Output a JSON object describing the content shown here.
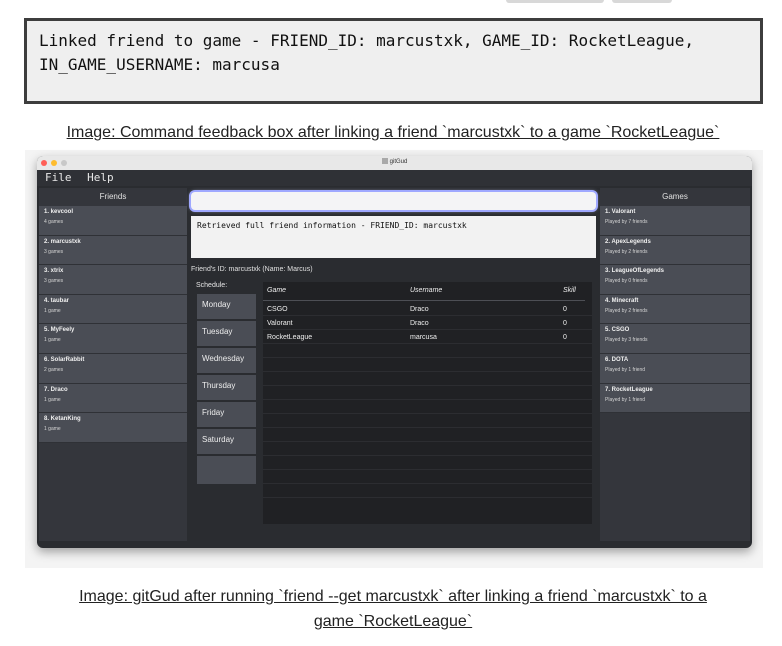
{
  "command_feedback": {
    "line1": "Linked friend to game - FRIEND_ID: marcustxk, GAME_ID: RocketLeague,",
    "line2": "IN_GAME_USERNAME: marcusa"
  },
  "caption1": "Image: Command feedback box after linking a friend `marcustxk` to a game `RocketLeague`",
  "caption2_line1": "Image: gitGud after running `friend --get marcustxk` after linking a friend `marcustxk` to a",
  "caption2_line2": "game `RocketLeague`",
  "app": {
    "window_title": "gitGud",
    "menu": [
      "File",
      "Help"
    ],
    "friends_header": "Friends",
    "games_header": "Games",
    "friends": [
      {
        "name": "1. kevcool",
        "sub": "4 games"
      },
      {
        "name": "2. marcustxk",
        "sub": "3 games"
      },
      {
        "name": "3. xtrix",
        "sub": "3 games"
      },
      {
        "name": "4. taubar",
        "sub": "1 game"
      },
      {
        "name": "5. MyFeely",
        "sub": "1 game"
      },
      {
        "name": "6. SolarRabbit",
        "sub": "2 games"
      },
      {
        "name": "7. Draco",
        "sub": "1 game"
      },
      {
        "name": "8. KetanKing",
        "sub": "1 game"
      }
    ],
    "games": [
      {
        "name": "1. Valorant",
        "sub": "Played by 7 friends"
      },
      {
        "name": "2. ApexLegends",
        "sub": "Played by 2 friends"
      },
      {
        "name": "3. LeagueOfLegends",
        "sub": "Played by 0 friends"
      },
      {
        "name": "4. Minecraft",
        "sub": "Played by 2 friends"
      },
      {
        "name": "5. CSGO",
        "sub": "Played by 3 friends"
      },
      {
        "name": "6. DOTA",
        "sub": "Played by 1 friend"
      },
      {
        "name": "7. RocketLeague",
        "sub": "Played by 1 friend"
      }
    ],
    "command_input_value": "",
    "result_text": "Retrieved full friend information - FRIEND_ID: marcustxk",
    "friend_id_label": "Friend's ID: marcustxk (Name: Marcus)",
    "schedule_label": "Schedule:",
    "days": [
      "Monday",
      "Tuesday",
      "Wednesday",
      "Thursday",
      "Friday",
      "Saturday",
      "Sunday"
    ],
    "table_headers": [
      "Game",
      "Username",
      "Skill"
    ],
    "table_rows": [
      [
        "CSGO",
        "Draco",
        "0"
      ],
      [
        "Valorant",
        "Draco",
        "0"
      ],
      [
        "RocketLeague",
        "marcusa",
        "0"
      ]
    ]
  },
  "colors": {
    "window_bg": "#2a2c30",
    "list_item_bg": "#4a4d55",
    "input_focus": "#9fa8ff",
    "close": "#ff5f57",
    "minimize": "#febc2e",
    "maximize": "#c8c8c8"
  }
}
